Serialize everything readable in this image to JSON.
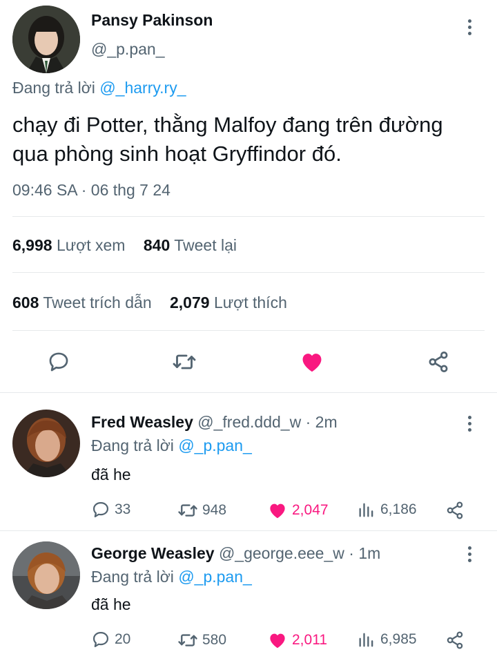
{
  "main_tweet": {
    "author_name": "Pansy Pakinson",
    "author_handle": "@_p.pan_",
    "reply_prefix": "Đang trả lời",
    "reply_to": "@_harry.ry_",
    "text_line1": "chạy đi Potter, thằng Malfoy đang trên đường",
    "text_line2": "qua phòng sinh hoạt Gryffindor đó.",
    "timestamp": "09:46 SA · 06 thg 7 24",
    "stats": {
      "views_count": "6,998",
      "views_label": "Lượt xem",
      "retweets_count": "840",
      "retweets_label": "Tweet lại",
      "quotes_count": "608",
      "quotes_label": "Tweet trích dẫn",
      "likes_count": "2,079",
      "likes_label": "Lượt thích"
    },
    "actions": [
      "reply-icon",
      "retweet-icon",
      "like-icon",
      "share-icon"
    ],
    "like_color": "#f91880"
  },
  "replies": [
    {
      "author_name": "Fred Weasley",
      "author_handle": "@_fred.ddd_w",
      "time": "· 2m",
      "reply_prefix": "Đang trả lời",
      "reply_to": "@_p.pan_",
      "text": "đã he",
      "reply_count": "33",
      "retweet_count": "948",
      "like_count": "2,047",
      "view_count": "6,186"
    },
    {
      "author_name": "George Weasley",
      "author_handle": "@_george.eee_w",
      "time": "· 1m",
      "reply_prefix": "Đang trả lời",
      "reply_to": "@_p.pan_",
      "text": "đã he",
      "reply_count": "20",
      "retweet_count": "580",
      "like_count": "2,011",
      "view_count": "6,985"
    }
  ],
  "colors": {
    "accent": "#1d9bf0",
    "like": "#f91880",
    "secondary_text": "#536471"
  }
}
